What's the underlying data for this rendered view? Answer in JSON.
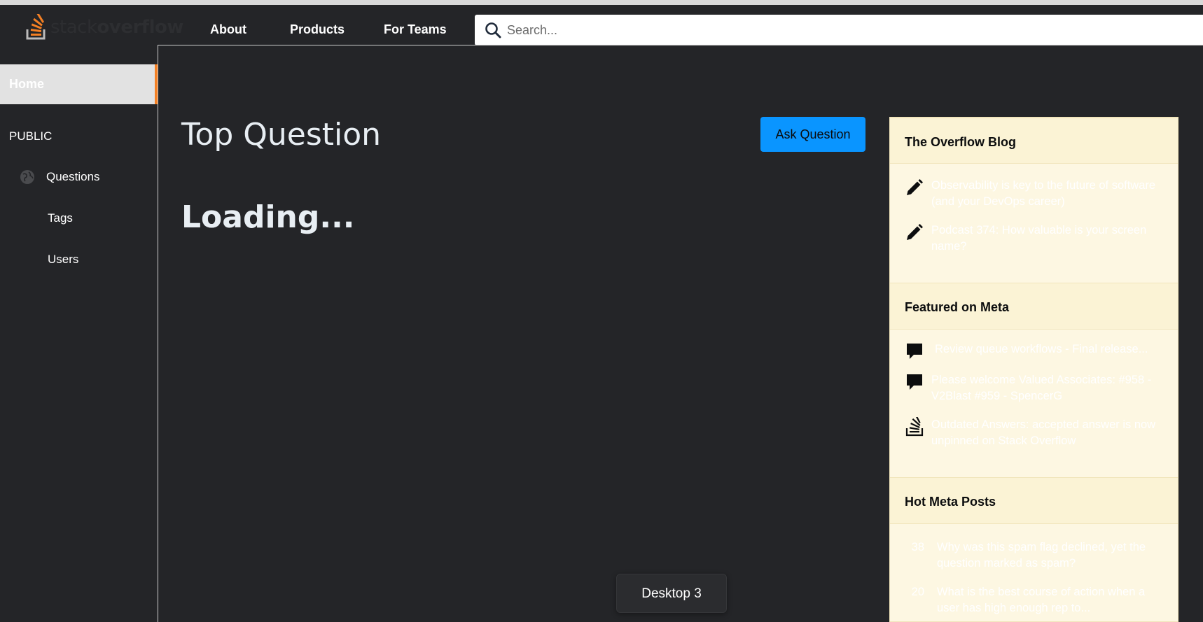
{
  "header": {
    "logo_text_light": "stack",
    "logo_text_bold": "overflow",
    "nav": [
      "About",
      "Products",
      "For Teams"
    ],
    "search_placeholder": "Search..."
  },
  "sidebar": {
    "home": "Home",
    "public_label": "PUBLIC",
    "items": [
      "Questions",
      "Tags",
      "Users"
    ]
  },
  "main": {
    "title": "Top Question",
    "ask_button": "Ask Question",
    "loading": "Loading..."
  },
  "widget": {
    "blog_title": "The Overflow Blog",
    "blog_items": [
      "Observability is key to the future of software (and your DevOps career)",
      "Podcast 374: How valuable is your screen name?"
    ],
    "meta_title": "Featured on Meta",
    "meta_items": [
      "Review queue workflows - Final release...",
      "Please welcome Valued Associates: #958 - V2Blast #959 - SpencerG",
      "Outdated Answers: accepted answer is now unpinned on Stack Overflow"
    ],
    "hot_title": "Hot Meta Posts",
    "hot_items": [
      {
        "count": "38",
        "text": "Why was this spam flag declined, yet the question marked as spam?"
      },
      {
        "count": "20",
        "text": "What is the best course of action when a user has high enough rep to..."
      }
    ]
  },
  "toast": "Desktop 3",
  "colors": {
    "accent": "#f48024",
    "button": "#0a95ff",
    "background": "#242528",
    "widget_bg": "#fdf7e2"
  }
}
